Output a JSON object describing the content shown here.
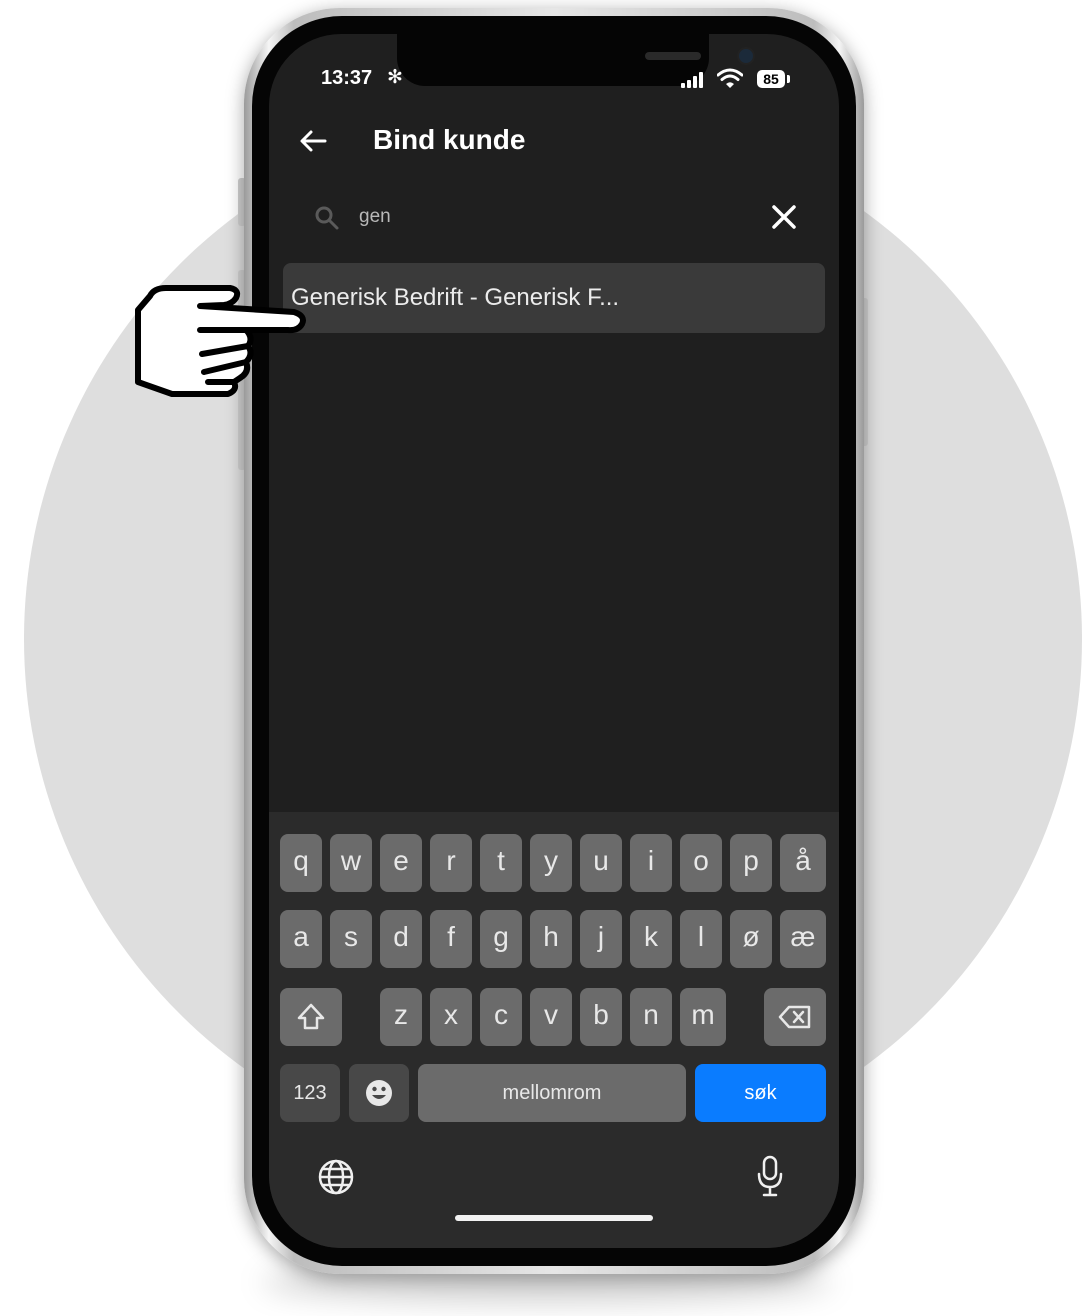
{
  "status_bar": {
    "time": "13:37",
    "extra_icon": "✻",
    "battery": "85"
  },
  "header": {
    "title": "Bind kunde"
  },
  "search": {
    "value": "gen"
  },
  "results": [
    {
      "label": "Generisk Bedrift - Generisk F..."
    }
  ],
  "keyboard": {
    "row1": [
      "q",
      "w",
      "e",
      "r",
      "t",
      "y",
      "u",
      "i",
      "o",
      "p",
      "å"
    ],
    "row2": [
      "a",
      "s",
      "d",
      "f",
      "g",
      "h",
      "j",
      "k",
      "l",
      "ø",
      "æ"
    ],
    "row3": [
      "z",
      "x",
      "c",
      "v",
      "b",
      "n",
      "m"
    ],
    "numbers_label": "123",
    "space_label": "mellomrom",
    "action_label": "søk"
  },
  "colors": {
    "screen_bg": "#1f1f1f",
    "result_bg": "#3a3a3a",
    "keyboard_bg": "#2b2b2b",
    "action_key": "#0a7cff",
    "backdrop_circle": "#dedede"
  },
  "icons": [
    "back-arrow-icon",
    "search-icon",
    "close-icon",
    "shift-icon",
    "backspace-icon",
    "emoji-icon",
    "globe-icon",
    "microphone-icon",
    "pointing-hand-icon",
    "wifi-icon",
    "signal-icon",
    "battery-icon"
  ]
}
